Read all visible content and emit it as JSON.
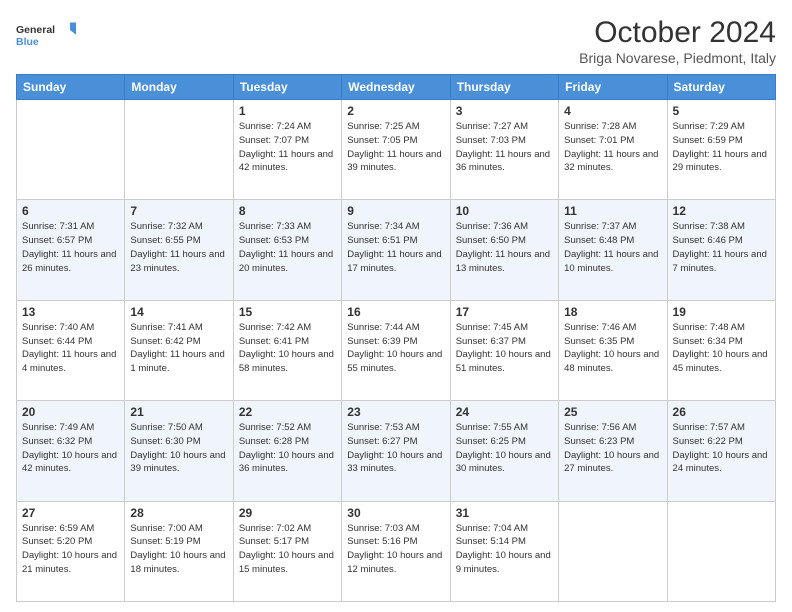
{
  "header": {
    "logo_line1": "General",
    "logo_line2": "Blue",
    "month_title": "October 2024",
    "location": "Briga Novarese, Piedmont, Italy"
  },
  "days_of_week": [
    "Sunday",
    "Monday",
    "Tuesday",
    "Wednesday",
    "Thursday",
    "Friday",
    "Saturday"
  ],
  "weeks": [
    [
      {
        "day": "",
        "info": ""
      },
      {
        "day": "",
        "info": ""
      },
      {
        "day": "1",
        "info": "Sunrise: 7:24 AM\nSunset: 7:07 PM\nDaylight: 11 hours and 42 minutes."
      },
      {
        "day": "2",
        "info": "Sunrise: 7:25 AM\nSunset: 7:05 PM\nDaylight: 11 hours and 39 minutes."
      },
      {
        "day": "3",
        "info": "Sunrise: 7:27 AM\nSunset: 7:03 PM\nDaylight: 11 hours and 36 minutes."
      },
      {
        "day": "4",
        "info": "Sunrise: 7:28 AM\nSunset: 7:01 PM\nDaylight: 11 hours and 32 minutes."
      },
      {
        "day": "5",
        "info": "Sunrise: 7:29 AM\nSunset: 6:59 PM\nDaylight: 11 hours and 29 minutes."
      }
    ],
    [
      {
        "day": "6",
        "info": "Sunrise: 7:31 AM\nSunset: 6:57 PM\nDaylight: 11 hours and 26 minutes."
      },
      {
        "day": "7",
        "info": "Sunrise: 7:32 AM\nSunset: 6:55 PM\nDaylight: 11 hours and 23 minutes."
      },
      {
        "day": "8",
        "info": "Sunrise: 7:33 AM\nSunset: 6:53 PM\nDaylight: 11 hours and 20 minutes."
      },
      {
        "day": "9",
        "info": "Sunrise: 7:34 AM\nSunset: 6:51 PM\nDaylight: 11 hours and 17 minutes."
      },
      {
        "day": "10",
        "info": "Sunrise: 7:36 AM\nSunset: 6:50 PM\nDaylight: 11 hours and 13 minutes."
      },
      {
        "day": "11",
        "info": "Sunrise: 7:37 AM\nSunset: 6:48 PM\nDaylight: 11 hours and 10 minutes."
      },
      {
        "day": "12",
        "info": "Sunrise: 7:38 AM\nSunset: 6:46 PM\nDaylight: 11 hours and 7 minutes."
      }
    ],
    [
      {
        "day": "13",
        "info": "Sunrise: 7:40 AM\nSunset: 6:44 PM\nDaylight: 11 hours and 4 minutes."
      },
      {
        "day": "14",
        "info": "Sunrise: 7:41 AM\nSunset: 6:42 PM\nDaylight: 11 hours and 1 minute."
      },
      {
        "day": "15",
        "info": "Sunrise: 7:42 AM\nSunset: 6:41 PM\nDaylight: 10 hours and 58 minutes."
      },
      {
        "day": "16",
        "info": "Sunrise: 7:44 AM\nSunset: 6:39 PM\nDaylight: 10 hours and 55 minutes."
      },
      {
        "day": "17",
        "info": "Sunrise: 7:45 AM\nSunset: 6:37 PM\nDaylight: 10 hours and 51 minutes."
      },
      {
        "day": "18",
        "info": "Sunrise: 7:46 AM\nSunset: 6:35 PM\nDaylight: 10 hours and 48 minutes."
      },
      {
        "day": "19",
        "info": "Sunrise: 7:48 AM\nSunset: 6:34 PM\nDaylight: 10 hours and 45 minutes."
      }
    ],
    [
      {
        "day": "20",
        "info": "Sunrise: 7:49 AM\nSunset: 6:32 PM\nDaylight: 10 hours and 42 minutes."
      },
      {
        "day": "21",
        "info": "Sunrise: 7:50 AM\nSunset: 6:30 PM\nDaylight: 10 hours and 39 minutes."
      },
      {
        "day": "22",
        "info": "Sunrise: 7:52 AM\nSunset: 6:28 PM\nDaylight: 10 hours and 36 minutes."
      },
      {
        "day": "23",
        "info": "Sunrise: 7:53 AM\nSunset: 6:27 PM\nDaylight: 10 hours and 33 minutes."
      },
      {
        "day": "24",
        "info": "Sunrise: 7:55 AM\nSunset: 6:25 PM\nDaylight: 10 hours and 30 minutes."
      },
      {
        "day": "25",
        "info": "Sunrise: 7:56 AM\nSunset: 6:23 PM\nDaylight: 10 hours and 27 minutes."
      },
      {
        "day": "26",
        "info": "Sunrise: 7:57 AM\nSunset: 6:22 PM\nDaylight: 10 hours and 24 minutes."
      }
    ],
    [
      {
        "day": "27",
        "info": "Sunrise: 6:59 AM\nSunset: 5:20 PM\nDaylight: 10 hours and 21 minutes."
      },
      {
        "day": "28",
        "info": "Sunrise: 7:00 AM\nSunset: 5:19 PM\nDaylight: 10 hours and 18 minutes."
      },
      {
        "day": "29",
        "info": "Sunrise: 7:02 AM\nSunset: 5:17 PM\nDaylight: 10 hours and 15 minutes."
      },
      {
        "day": "30",
        "info": "Sunrise: 7:03 AM\nSunset: 5:16 PM\nDaylight: 10 hours and 12 minutes."
      },
      {
        "day": "31",
        "info": "Sunrise: 7:04 AM\nSunset: 5:14 PM\nDaylight: 10 hours and 9 minutes."
      },
      {
        "day": "",
        "info": ""
      },
      {
        "day": "",
        "info": ""
      }
    ]
  ]
}
